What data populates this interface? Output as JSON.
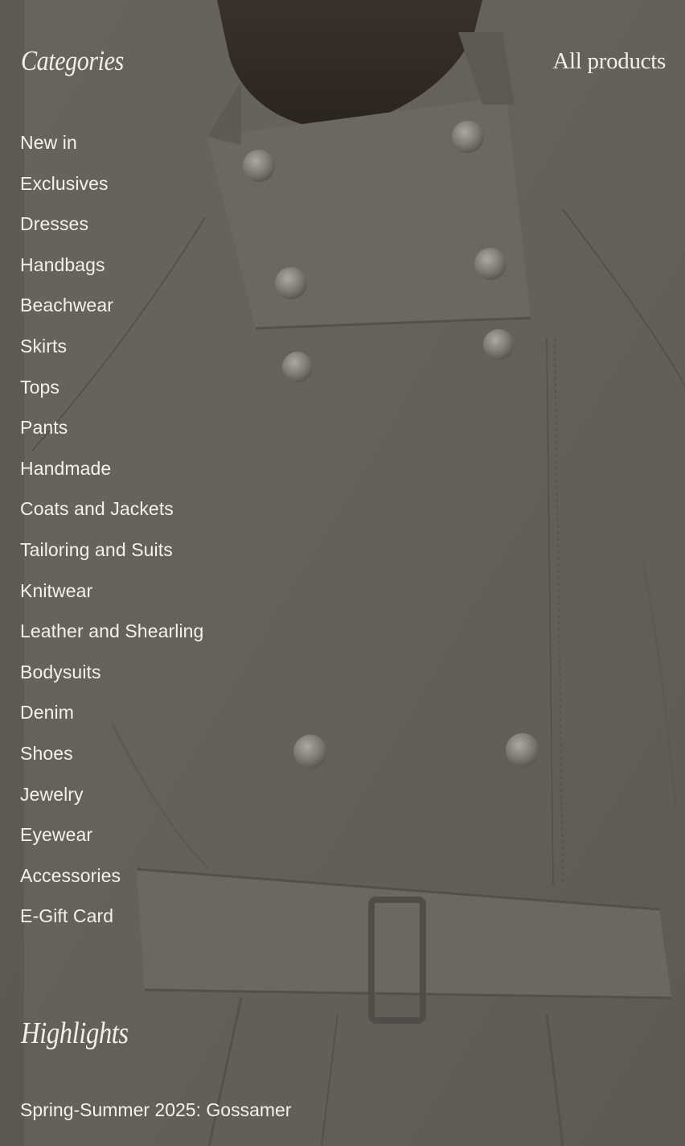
{
  "menu": {
    "categories_heading": "Categories",
    "all_products_label": "All products",
    "categories": [
      {
        "label": "New in"
      },
      {
        "label": "Exclusives"
      },
      {
        "label": "Dresses"
      },
      {
        "label": "Handbags"
      },
      {
        "label": "Beachwear"
      },
      {
        "label": "Skirts"
      },
      {
        "label": "Tops"
      },
      {
        "label": "Pants"
      },
      {
        "label": "Handmade"
      },
      {
        "label": "Coats and Jackets"
      },
      {
        "label": "Tailoring and Suits"
      },
      {
        "label": "Knitwear"
      },
      {
        "label": "Leather and Shearling"
      },
      {
        "label": "Bodysuits"
      },
      {
        "label": "Denim"
      },
      {
        "label": "Shoes"
      },
      {
        "label": "Jewelry"
      },
      {
        "label": "Eyewear"
      },
      {
        "label": "Accessories"
      },
      {
        "label": "E-Gift Card"
      }
    ],
    "highlights_heading": "Highlights",
    "highlights": [
      {
        "label": "Spring-Summer 2025: Gossamer"
      }
    ]
  },
  "theme": {
    "text_color": "#f4f1ec",
    "background_color": "#6f6a63"
  }
}
